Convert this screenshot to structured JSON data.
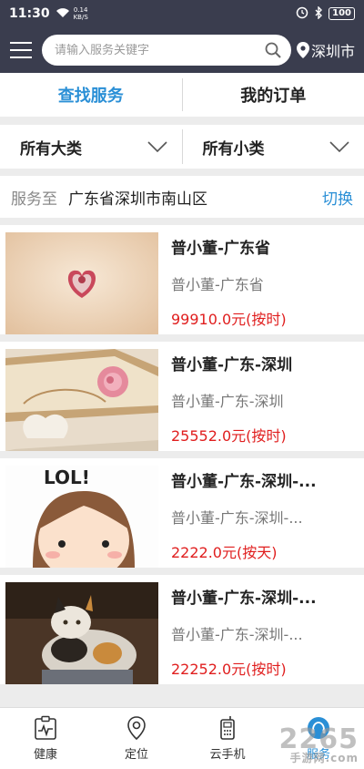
{
  "status": {
    "time": "11:30",
    "speed_value": "0.14",
    "speed_unit": "KB/S",
    "battery": "100"
  },
  "header": {
    "search_placeholder": "请输入服务关键字",
    "city": "深圳市"
  },
  "tabs": [
    {
      "label": "查找服务"
    },
    {
      "label": "我的订单"
    }
  ],
  "filters": [
    {
      "label": "所有大类"
    },
    {
      "label": "所有小类"
    }
  ],
  "location": {
    "label": "服务至",
    "value": "广东省深圳市南山区",
    "switch": "切换"
  },
  "items": [
    {
      "title": "普小董-广东省",
      "subtitle": "普小董-广东省",
      "price": "99910.0元(按时)",
      "image": "heart-box-image"
    },
    {
      "title": "普小董-广东-深圳",
      "subtitle": "普小董-广东-深圳",
      "price": "25552.0元(按时)",
      "image": "rose-book-image"
    },
    {
      "title": "普小董-广东-深圳-...",
      "subtitle": "普小董-广东-深圳-...",
      "price": "2222.0元(按天)",
      "image": "lol-girl-image"
    },
    {
      "title": "普小董-广东-深圳-...",
      "subtitle": "普小董-广东-深圳-...",
      "price": "22252.0元(按时)",
      "image": "cat-image"
    }
  ],
  "nav": [
    {
      "label": "健康",
      "icon": "health-monitor-icon"
    },
    {
      "label": "定位",
      "icon": "location-pin-icon"
    },
    {
      "label": "云手机",
      "icon": "phone-icon"
    },
    {
      "label": "服务",
      "icon": "service-icon"
    }
  ],
  "watermark": {
    "brand": "2265",
    "sub": "手游网",
    "domain": ".com"
  },
  "colors": {
    "header": "#3a3d4e",
    "accent": "#2a8fd6",
    "price": "#e01e1e"
  }
}
